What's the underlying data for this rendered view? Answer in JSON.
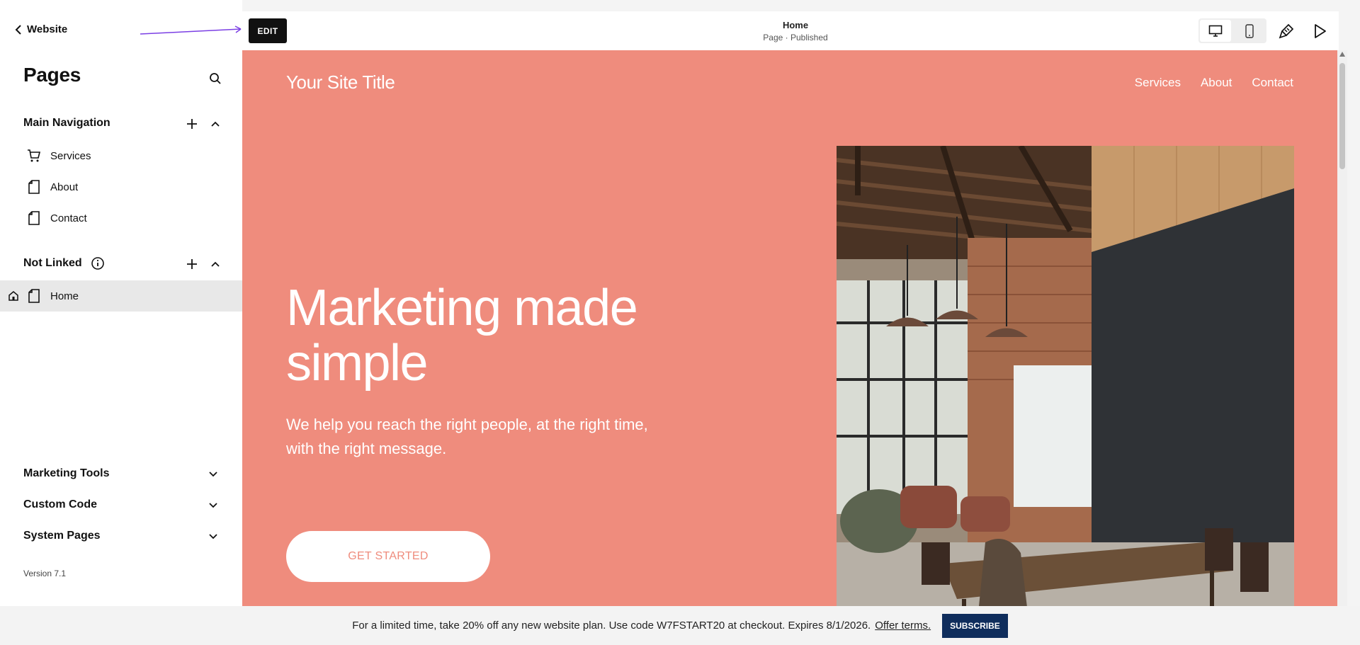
{
  "sidebar": {
    "back_label": "Website",
    "title": "Pages",
    "main_nav": {
      "title": "Main Navigation",
      "items": [
        {
          "label": "Services",
          "icon": "cart-icon"
        },
        {
          "label": "About",
          "icon": "page-icon"
        },
        {
          "label": "Contact",
          "icon": "page-icon"
        }
      ]
    },
    "not_linked": {
      "title": "Not Linked",
      "items": [
        {
          "label": "Home",
          "icon": "page-icon",
          "home": true,
          "active": true
        }
      ]
    },
    "collapsed_sections": [
      {
        "label": "Marketing Tools"
      },
      {
        "label": "Custom Code"
      },
      {
        "label": "System Pages"
      }
    ],
    "version": "Version 7.1"
  },
  "toolbar": {
    "edit_label": "EDIT",
    "page_title": "Home",
    "page_status": "Page · Published"
  },
  "site": {
    "title": "Your Site Title",
    "nav": [
      "Services",
      "About",
      "Contact"
    ],
    "hero_heading": "Marketing made simple",
    "hero_text": "We help you reach the right people, at the right time, with the right message.",
    "cta_label": "GET STARTED",
    "background_color": "#ef8c7d"
  },
  "promo": {
    "text": "For a limited time, take 20% off any new website plan. Use code W7FSTART20 at checkout. Expires 8/1/2026.",
    "terms_label": "Offer terms.",
    "subscribe_label": "SUBSCRIBE"
  },
  "colors": {
    "accent_arrow": "#7b3fe4",
    "subscribe_bg": "#0f2d5c"
  }
}
